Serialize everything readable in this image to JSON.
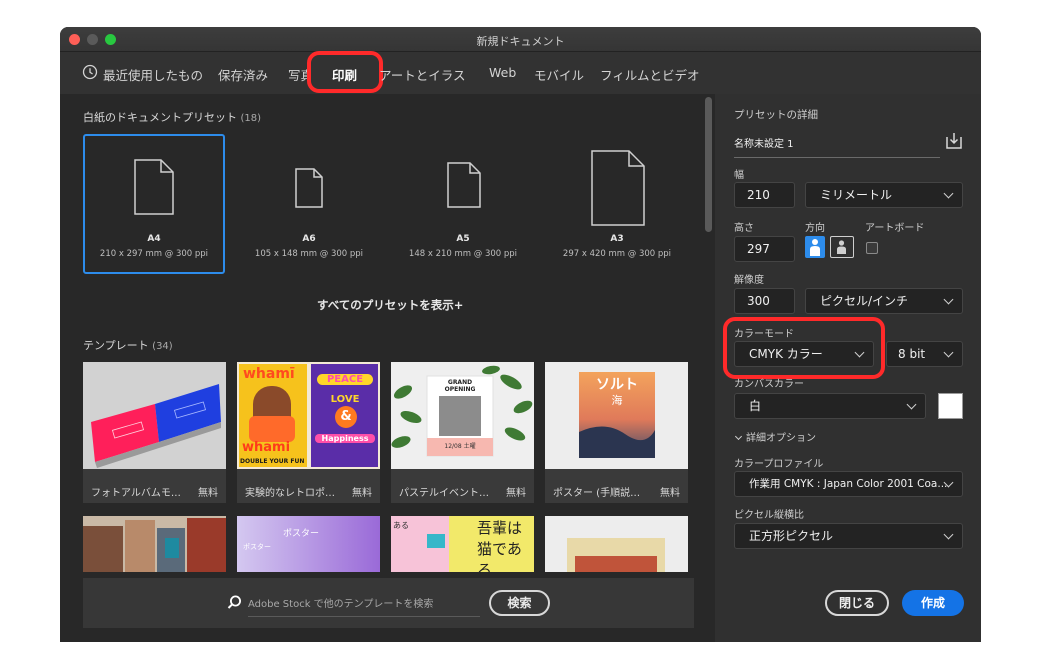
{
  "window": {
    "title": "新規ドキュメント"
  },
  "tabs": [
    {
      "label": "最近使用したもの"
    },
    {
      "label": "保存済み"
    },
    {
      "label": "写真"
    },
    {
      "label": "印刷"
    },
    {
      "label": "アートとイラスト"
    },
    {
      "label": "Web"
    },
    {
      "label": "モバイル"
    },
    {
      "label": "フィルムとビデオ"
    }
  ],
  "active_tab": "印刷",
  "blank_presets": {
    "heading": "白紙のドキュメントプリセット",
    "count": "(18)",
    "items": [
      {
        "name": "A4",
        "size": "210 x 297 mm @ 300 ppi",
        "selected": true
      },
      {
        "name": "A6",
        "size": "105 x 148 mm @ 300 ppi",
        "selected": false
      },
      {
        "name": "A5",
        "size": "148 x 210 mm @ 300 ppi",
        "selected": false
      },
      {
        "name": "A3",
        "size": "297 x 420 mm @ 300 ppi",
        "selected": false
      }
    ],
    "show_all": "すべてのプリセットを表示+"
  },
  "templates": {
    "heading": "テンプレート",
    "count": "(34)",
    "items": [
      {
        "caption": "フォトアルバムモ…",
        "price": "無料"
      },
      {
        "caption": "実験的なレトロポ…",
        "price": "無料",
        "art_text": [
          "whamī",
          "PEACE",
          "LOVE",
          "&",
          "Happiness",
          "whami",
          "DOUBLE YOUR FUN"
        ]
      },
      {
        "caption": "パステルイベント…",
        "price": "無料",
        "art_text": [
          "GRAND",
          "OPENING",
          "12/08 土曜"
        ]
      },
      {
        "caption": "ポスター (手順説…",
        "price": "無料",
        "art_text": [
          "ソルト",
          "海"
        ]
      }
    ],
    "row2_art_text": [
      "ポスター",
      "ポスター",
      "ある",
      "吾輩は",
      "猫である"
    ]
  },
  "search": {
    "placeholder": "Adobe Stock で他のテンプレートを検索",
    "button": "検索"
  },
  "details": {
    "heading": "プリセットの詳細",
    "preset_name": "名称未設定 1",
    "width_label": "幅",
    "width_value": "210",
    "unit": "ミリメートル",
    "height_label": "高さ",
    "height_value": "297",
    "orientation_label": "方向",
    "artboard_label": "アートボード",
    "resolution_label": "解像度",
    "resolution_value": "300",
    "resolution_unit": "ピクセル/インチ",
    "color_mode_label": "カラーモード",
    "color_mode": "CMYK カラー",
    "bit_depth": "8 bit",
    "canvas_color_label": "カンバスカラー",
    "canvas_color": "白",
    "advanced_label": "詳細オプション",
    "profile_label": "カラープロファイル",
    "profile_value": "作業用 CMYK : Japan Color 2001 Coa...",
    "pixel_ratio_label": "ピクセル縦横比",
    "pixel_ratio_value": "正方形ピクセル"
  },
  "actions": {
    "close": "閉じる",
    "create": "作成"
  },
  "colors": {
    "highlight": "#ff2a2a",
    "accent_blue": "#1473e6",
    "selection_blue": "#2d8ceb",
    "traffic_close": "#fe5f57",
    "traffic_min": "#febc2e",
    "traffic_max": "#28c840"
  }
}
